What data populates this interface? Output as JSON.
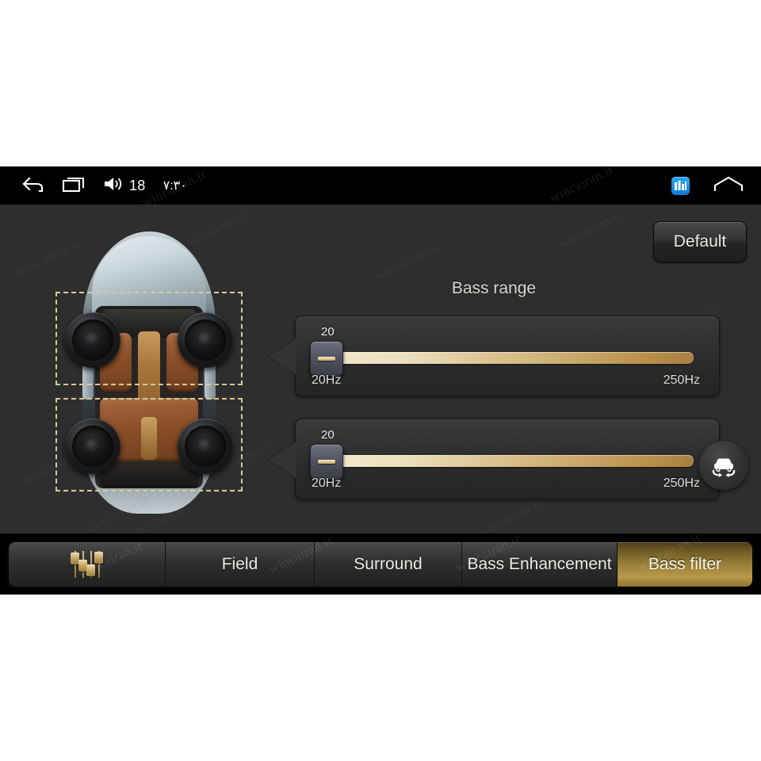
{
  "statusbar": {
    "back_icon": "back-arrow-icon",
    "recents_icon": "recent-apps-icon",
    "volume_icon": "volume-icon",
    "volume_value": "18",
    "time": "۷:۳۰",
    "app_icon": "equalizer-app-icon",
    "home_icon": "home-icon"
  },
  "content": {
    "default_button": "Default",
    "title": "Bass range",
    "car_fab_icon": "car-rotate-icon"
  },
  "sliders": [
    {
      "value": "20",
      "min_label": "20Hz",
      "max_label": "250Hz",
      "position_pct": 0,
      "min_hz": 20,
      "max_hz": 250
    },
    {
      "value": "20",
      "min_label": "20Hz",
      "max_label": "250Hz",
      "position_pct": 0,
      "min_hz": 20,
      "max_hz": 250
    }
  ],
  "car_diagram": {
    "speakers": [
      "front-left",
      "front-right",
      "rear-left",
      "rear-right"
    ],
    "selection_boxes": [
      "front-row-selection",
      "rear-row-selection"
    ]
  },
  "tabs": [
    {
      "label": "",
      "icon": "equalizer-icon",
      "active": false
    },
    {
      "label": "Field",
      "active": false
    },
    {
      "label": "Surround",
      "active": false
    },
    {
      "label": "Bass Enhancement",
      "active": false
    },
    {
      "label": "Bass filter",
      "active": true
    }
  ],
  "colors": {
    "accent_gold": "#b9994a",
    "track_light": "#f2e9cd",
    "track_dark": "#a87f3e",
    "panel_bg": "#2e2e2e",
    "selection_dash": "#d8cb96"
  },
  "watermark": "wincairan.ir"
}
